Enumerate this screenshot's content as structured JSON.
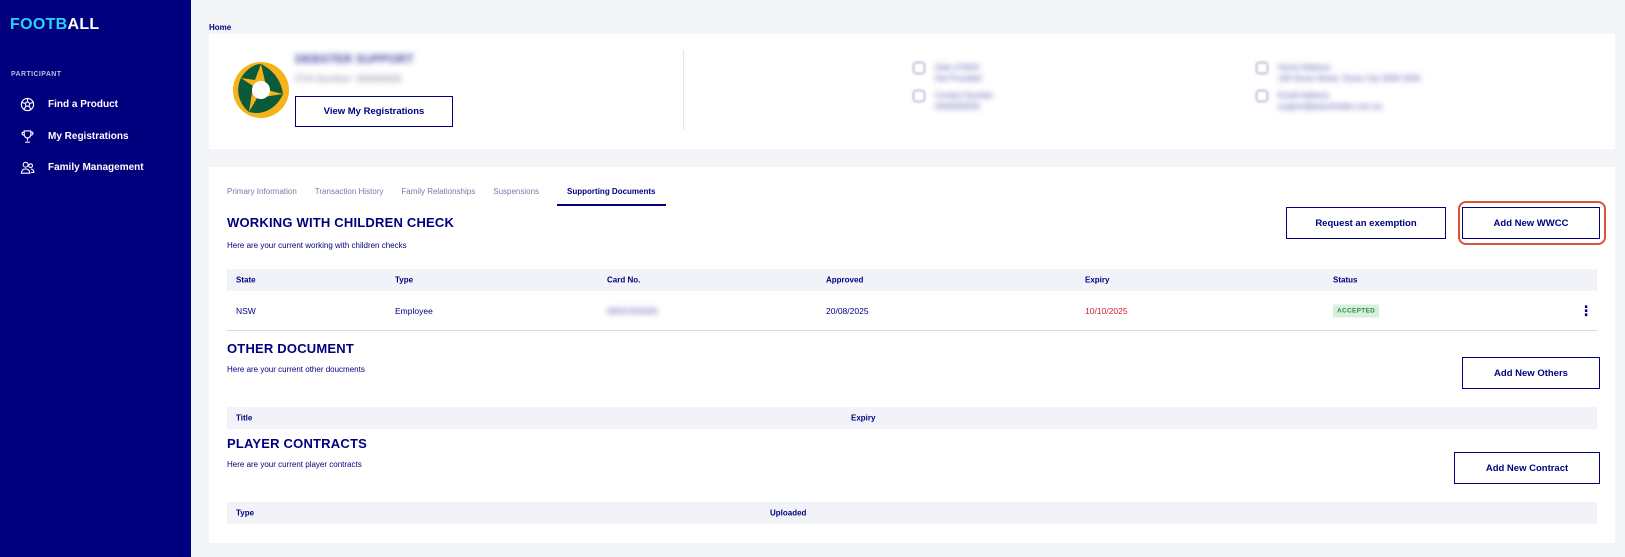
{
  "sidebar": {
    "logo_part1": "FOOTB",
    "logo_part2": "ALL",
    "section_label": "PARTICIPANT",
    "items": [
      {
        "label": "Find a Product",
        "icon": "soccer-ball-icon"
      },
      {
        "label": "My Registrations",
        "icon": "trophy-icon"
      },
      {
        "label": "Family Management",
        "icon": "people-icon"
      }
    ]
  },
  "breadcrumb": "Home",
  "profile": {
    "name": "DEBSTER SUPPORT",
    "ffa_number": "FFA Number: 99999999",
    "view_registrations_label": "View My Registrations",
    "contact": {
      "gender_label": "Date of Birth",
      "gender_value": "Not Provided",
      "phone_label": "Contact Number",
      "phone_value": "0400000000",
      "address_label": "Home Address",
      "address_value": "100 Some Street, Some City NSW 2000",
      "email_label": "Email Address",
      "email_value": "support@placeholder.com.au"
    }
  },
  "tabs": [
    "Primary Information",
    "Transaction History",
    "Family Relationships",
    "Suspensions",
    "Supporting Documents"
  ],
  "active_tab": "Supporting Documents",
  "wwcc": {
    "title": "WORKING WITH CHILDREN CHECK",
    "subtitle": "Here are your current working with children checks",
    "exemption_button": "Request an exemption",
    "add_button": "Add New WWCC",
    "columns": [
      "State",
      "Type",
      "Card No.",
      "Approved",
      "Expiry",
      "Status"
    ],
    "rows": [
      {
        "state": "NSW",
        "type": "Employee",
        "card_no": "WWC000000",
        "approved": "20/08/2025",
        "expiry": "10/10/2025",
        "status": "ACCEPTED"
      }
    ],
    "row_menu_icon": "kebab-menu-icon"
  },
  "other": {
    "title": "OTHER DOCUMENT",
    "subtitle": "Here are your current other doucments",
    "add_button": "Add New Others",
    "columns": [
      "Title",
      "Expiry"
    ]
  },
  "contracts": {
    "title": "PLAYER CONTRACTS",
    "subtitle": "Here are your current player contracts",
    "add_button": "Add New Contract",
    "columns": [
      "Type",
      "Uploaded"
    ]
  },
  "colors": {
    "sidebar_bg": "#00007f",
    "accent": "#00007f",
    "logo_cyan": "#27d3f7",
    "highlight": "#d9533b",
    "expiry_red": "#d02030",
    "accepted_bg": "#d6f0dc"
  }
}
